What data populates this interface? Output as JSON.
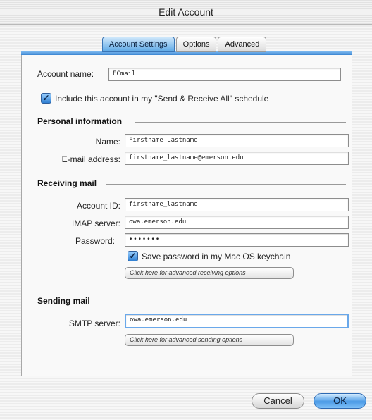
{
  "window": {
    "title": "Edit Account"
  },
  "tabs": [
    "Account Settings",
    "Options",
    "Advanced"
  ],
  "account": {
    "name_label": "Account name:",
    "name_value": "ECmail",
    "include_label": "Include this account in my \"Send & Receive All\" schedule",
    "include_checked": true
  },
  "personal": {
    "heading": "Personal information",
    "name_label": "Name:",
    "name_value": "Firstname Lastname",
    "email_label": "E-mail address:",
    "email_value": "firstname_lastname@emerson.edu"
  },
  "receiving": {
    "heading": "Receiving mail",
    "account_id_label": "Account ID:",
    "account_id_value": "firstname_lastname",
    "imap_label": "IMAP server:",
    "imap_value": "owa.emerson.edu",
    "password_label": "Password:",
    "password_value": "•••••••",
    "save_pw_label": "Save password in my Mac OS keychain",
    "save_pw_checked": true,
    "advanced_button": "Click here for advanced receiving options"
  },
  "sending": {
    "heading": "Sending mail",
    "smtp_label": "SMTP server:",
    "smtp_value": "owa.emerson.edu",
    "advanced_button": "Click here for advanced sending options"
  },
  "buttons": {
    "cancel": "Cancel",
    "ok": "OK"
  },
  "icons": {
    "checkbox": "checkmark-icon"
  },
  "colors": {
    "accent": "#3b86d2"
  }
}
